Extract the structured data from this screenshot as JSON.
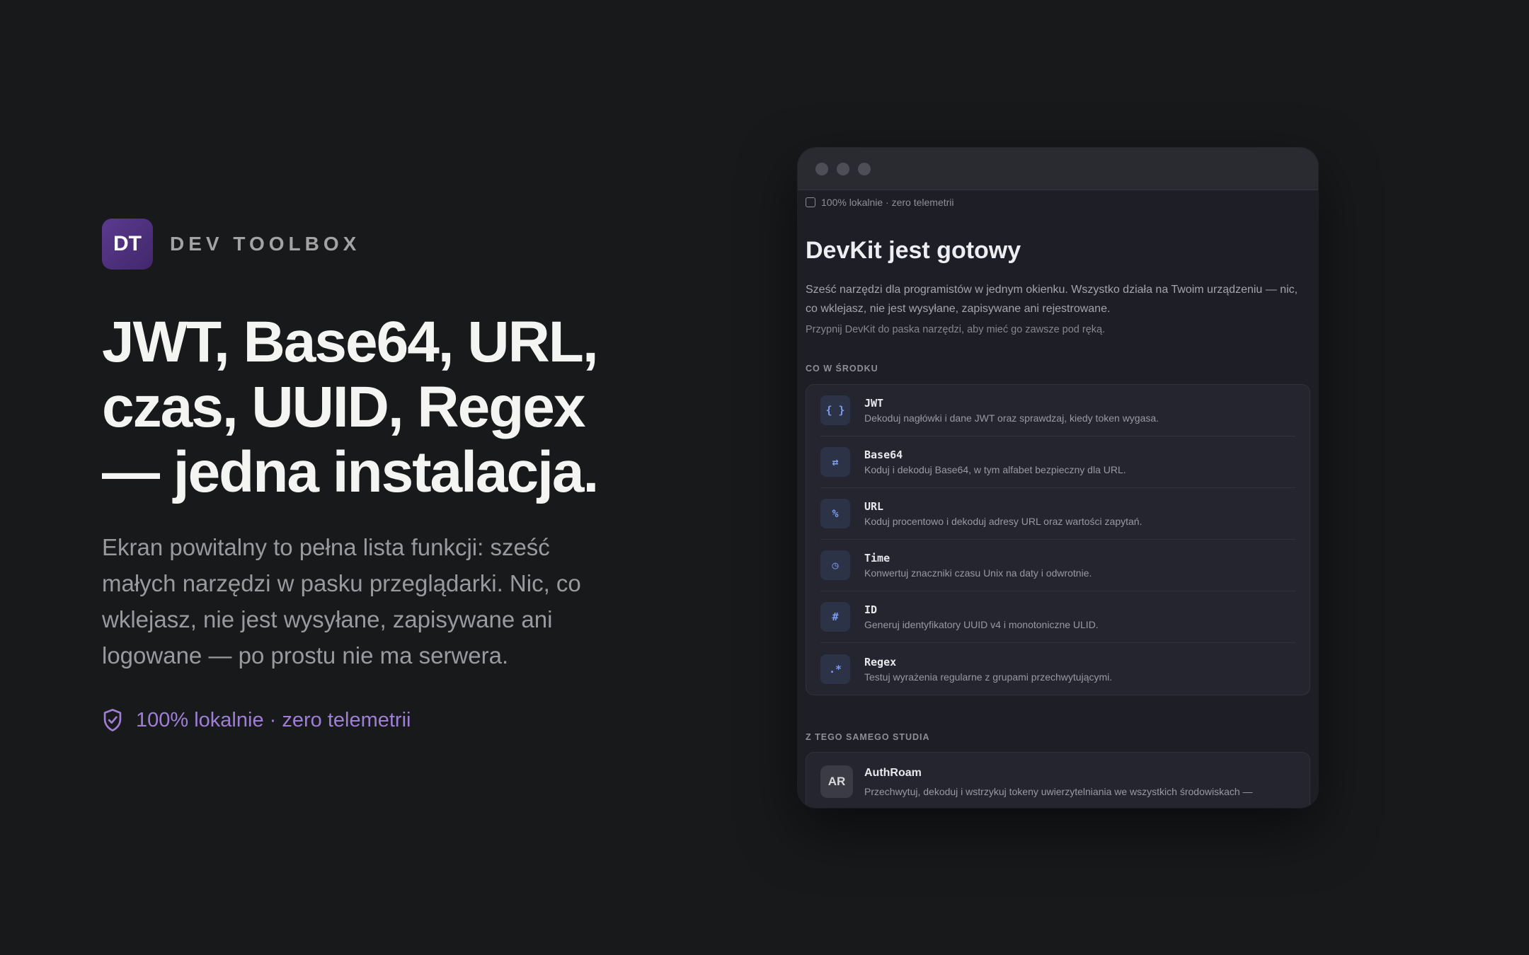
{
  "brand": {
    "logo": "DT",
    "name": "DEV TOOLBOX"
  },
  "hero": {
    "headline_lines": [
      "JWT, Base64, URL,",
      "czas, UUID, Regex",
      "— jedna instalacja."
    ],
    "subtext": "Ekran powitalny to pełna lista funkcji: sześć małych narzędzi w pasku przeglądarki. Nic, co wklejasz, nie jest wysyłane, zapisywane ani logowane — po prostu nie ma serwera.",
    "badge": "100% lokalnie · zero telemetrii"
  },
  "panel": {
    "topline": "100% lokalnie · zero telemetrii",
    "title": "DevKit jest gotowy",
    "intro": "Sześć narzędzi dla programistów w jednym okienku. Wszystko działa na Twoim urządzeniu — nic, co wklejasz, nie jest wysyłane, zapisywane ani rejestrowane.",
    "hint": "Przypnij DevKit do paska narzędzi, aby mieć go zawsze pod ręką.",
    "section_inside": "CO W ŚRODKU",
    "tools": [
      {
        "icon": "{ }",
        "name": "JWT",
        "desc": "Dekoduj nagłówki i dane JWT oraz sprawdzaj, kiedy token wygasa."
      },
      {
        "icon": "⇄",
        "name": "Base64",
        "desc": "Koduj i dekoduj Base64, w tym alfabet bezpieczny dla URL."
      },
      {
        "icon": "%",
        "name": "URL",
        "desc": "Koduj procentowo i dekoduj adresy URL oraz wartości zapytań."
      },
      {
        "icon": "◷",
        "name": "Time",
        "desc": "Konwertuj znaczniki czasu Unix na daty i odwrotnie."
      },
      {
        "icon": "#",
        "name": "ID",
        "desc": "Generuj identyfikatory UUID v4 i monotoniczne ULID."
      },
      {
        "icon": ".*",
        "name": "Regex",
        "desc": "Testuj wyrażenia regularne z grupami przechwytującymi."
      }
    ],
    "section_studio": "Z TEGO SAMEGO STUDIA",
    "studio_app": {
      "icon": "AR",
      "name": "AuthRoam",
      "desc": "Przechwytuj, dekoduj i wstrzykuj tokeny uwierzytelniania we wszystkich środowiskach —"
    }
  },
  "colors": {
    "accent": "#9f7fd6",
    "logo_bg": "#4e3280",
    "background": "#18191b"
  }
}
